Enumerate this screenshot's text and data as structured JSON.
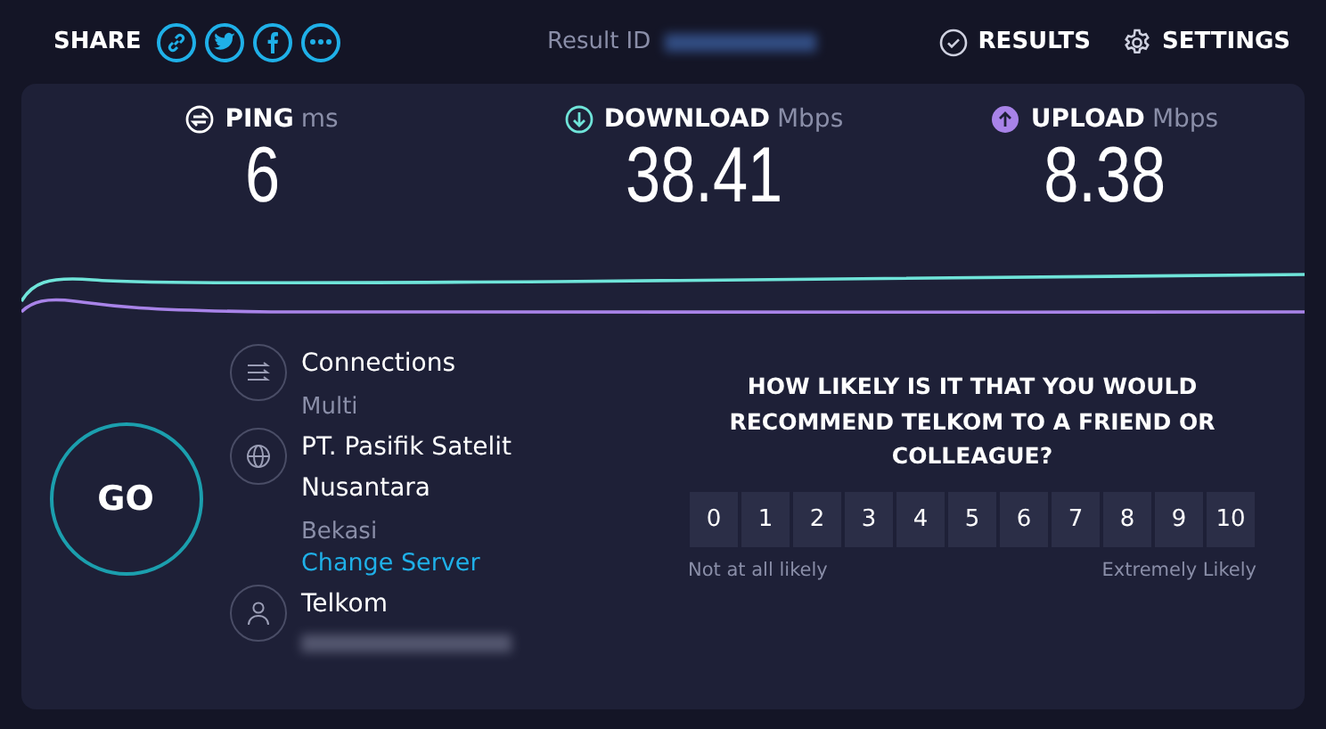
{
  "header": {
    "share_label": "SHARE",
    "share_buttons": [
      {
        "kind": "link"
      },
      {
        "kind": "twitter"
      },
      {
        "kind": "facebook"
      },
      {
        "kind": "more"
      }
    ],
    "result_id_label": "Result ID",
    "nav": [
      {
        "kind": "results",
        "label": "RESULTS"
      },
      {
        "kind": "settings",
        "label": "SETTINGS"
      }
    ]
  },
  "metrics": [
    {
      "kind": "ping",
      "label": "PING",
      "unit": "ms",
      "value": "6",
      "color": "#ffffff"
    },
    {
      "kind": "download",
      "label": "DOWNLOAD",
      "unit": "Mbps",
      "value": "38.41",
      "color": "#6fe4d9"
    },
    {
      "kind": "upload",
      "label": "UPLOAD",
      "unit": "Mbps",
      "value": "8.38",
      "color": "#a883e8"
    }
  ],
  "go_button": "GO",
  "info": [
    {
      "kind": "connections",
      "title": "Connections",
      "subtitle": "Multi"
    },
    {
      "kind": "server",
      "title": "PT. Pasifik Satelit Nusantara",
      "subtitle": "Bekasi",
      "link": "Change Server"
    },
    {
      "kind": "provider",
      "title": "Telkom"
    }
  ],
  "survey": {
    "question": "HOW LIKELY IS IT THAT YOU WOULD RECOMMEND TELKOM TO A FRIEND OR COLLEAGUE?",
    "scale": [
      "0",
      "1",
      "2",
      "3",
      "4",
      "5",
      "6",
      "7",
      "8",
      "9",
      "10"
    ],
    "low_label": "Not at all likely",
    "high_label": "Extremely Likely"
  }
}
